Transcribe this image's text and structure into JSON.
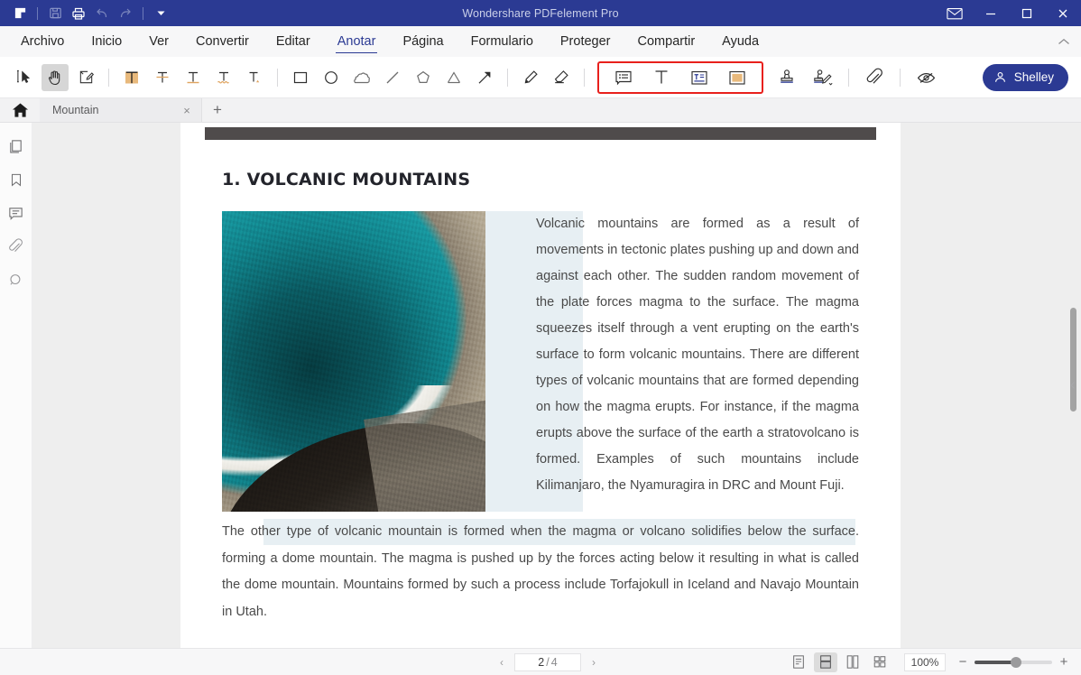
{
  "titlebar": {
    "app_title": "Wondershare PDFelement Pro",
    "quick_access": [
      {
        "name": "logo-icon",
        "label": "PDFelement"
      },
      {
        "name": "save-icon",
        "label": "Guardar"
      },
      {
        "name": "print-icon",
        "label": "Imprimir"
      },
      {
        "name": "undo-icon",
        "label": "Deshacer"
      },
      {
        "name": "redo-icon",
        "label": "Rehacer"
      },
      {
        "name": "customize-caret-icon",
        "label": "Personalizar"
      }
    ],
    "window_controls": [
      {
        "name": "mail-icon",
        "label": "Correo"
      },
      {
        "name": "minimize-icon",
        "label": "Minimizar"
      },
      {
        "name": "maximize-icon",
        "label": "Maximizar"
      },
      {
        "name": "close-icon",
        "label": "Cerrar"
      }
    ]
  },
  "menubar": {
    "items": [
      {
        "label": "Archivo",
        "active": false
      },
      {
        "label": "Inicio",
        "active": false
      },
      {
        "label": "Ver",
        "active": false
      },
      {
        "label": "Convertir",
        "active": false
      },
      {
        "label": "Editar",
        "active": false
      },
      {
        "label": "Anotar",
        "active": true
      },
      {
        "label": "Página",
        "active": false
      },
      {
        "label": "Formulario",
        "active": false
      },
      {
        "label": "Proteger",
        "active": false
      },
      {
        "label": "Compartir",
        "active": false
      },
      {
        "label": "Ayuda",
        "active": false
      }
    ],
    "collapse_label": "Contraer la cinta"
  },
  "toolbar": {
    "select_tool": "select-cursor-tool",
    "hand_tool": "hand-tool",
    "edit_tool": "edit-note-tool",
    "text_markup": [
      {
        "name": "highlight-tool",
        "label": "Resaltar"
      },
      {
        "name": "strikethrough-tool",
        "label": "Tachado"
      },
      {
        "name": "underline-tool",
        "label": "Subrayado"
      },
      {
        "name": "squiggly-underline-tool",
        "label": "Subrayado ondulado"
      },
      {
        "name": "caret-insert-tool",
        "label": "Insertar texto"
      }
    ],
    "shapes": [
      {
        "name": "rectangle-tool",
        "label": "Rectángulo"
      },
      {
        "name": "ellipse-tool",
        "label": "Elipse"
      },
      {
        "name": "cloud-tool",
        "label": "Nube"
      },
      {
        "name": "line-tool",
        "label": "Línea"
      },
      {
        "name": "polygon-tool",
        "label": "Polígono"
      },
      {
        "name": "polyline-tool",
        "label": "Línea poligonal"
      },
      {
        "name": "arrow-tool",
        "label": "Flecha"
      }
    ],
    "draw": [
      {
        "name": "pencil-tool",
        "label": "Lápiz"
      },
      {
        "name": "eraser-tool",
        "label": "Borrador"
      }
    ],
    "highlighted_group": {
      "outline_color": "#e8201c",
      "items": [
        {
          "name": "sticky-note-tool",
          "label": "Nota"
        },
        {
          "name": "typewriter-text-tool",
          "label": "Texto"
        },
        {
          "name": "text-box-tool",
          "label": "Cuadro de texto"
        },
        {
          "name": "area-highlight-tool",
          "label": "Resaltar área"
        }
      ]
    },
    "stamps": [
      {
        "name": "stamp-tool",
        "label": "Sello"
      },
      {
        "name": "signature-stamp-tool",
        "label": "Firma"
      }
    ],
    "attachment_tool": {
      "name": "attachment-tool",
      "label": "Adjuntar archivo"
    },
    "hide_annotations_tool": {
      "name": "hide-annotations-tool",
      "label": "Ocultar anotaciones"
    },
    "user": {
      "name": "Shelley",
      "accent_color": "#2b3a93"
    }
  },
  "tabs": {
    "home_label": "Inicio",
    "open_documents": [
      {
        "label": "Mountain",
        "close_label": "×"
      }
    ],
    "new_tab_label": "+"
  },
  "sidebar": {
    "items": [
      {
        "name": "thumbnails-icon",
        "label": "Miniaturas"
      },
      {
        "name": "bookmark-icon",
        "label": "Marcadores"
      },
      {
        "name": "comments-icon",
        "label": "Comentarios"
      },
      {
        "name": "attachments-icon",
        "label": "Adjuntos"
      },
      {
        "name": "search-icon",
        "label": "Buscar"
      }
    ],
    "collapse_label": "›"
  },
  "document": {
    "heading": "1. VOLCANIC MOUNTAINS",
    "figure_alt": "Aerial photo of a turquoise geothermal hot spring pool with mineral shoreline",
    "paragraph_1": "Volcanic mountains are formed as a result of movements in tectonic plates pushing up and down and against each other. The sudden random movement of the plate forces magma to the surface. The magma squeezes itself through a vent erupting on the earth's surface to form volcanic mountains. There are different types of volcanic mountains that are formed depending on how the magma erupts. For instance, if the magma erupts above the surface of the earth a stratovolcano is formed. Examples of such mountains include Kilimanjaro, the Nyamuragira in DRC and Mount Fuji.",
    "paragraph_2": "The other type of volcanic mountain is formed when the magma or volcano solidifies below the surface. forming a dome mountain. The magma is pushed up by the forces acting below it resulting in what is called the dome mountain. Mountains formed by such a process include Torfajokull in Iceland and Navajo Mountain in Utah.",
    "highlight_color": "#e7eff3"
  },
  "statusbar": {
    "prev_label": "‹",
    "next_label": "›",
    "current_page": "2",
    "page_separator": "/",
    "total_pages": "4",
    "view_modes": [
      {
        "name": "single-page-view",
        "label": "Página única",
        "selected": false
      },
      {
        "name": "continuous-view",
        "label": "Desplazamiento continuo",
        "selected": true
      },
      {
        "name": "two-page-view",
        "label": "Dos páginas",
        "selected": false
      },
      {
        "name": "grid-view",
        "label": "Cuadrícula",
        "selected": false
      }
    ],
    "zoom_level": "100%",
    "zoom_out_label": "−",
    "zoom_in_label": "+"
  }
}
